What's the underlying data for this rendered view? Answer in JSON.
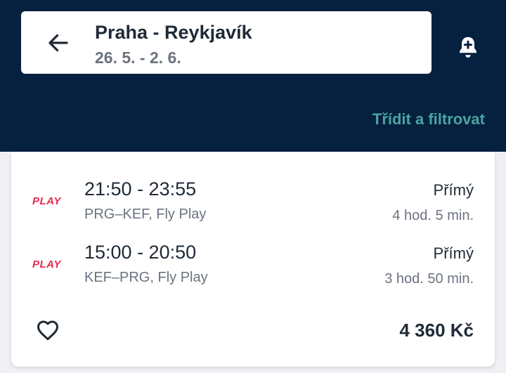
{
  "header": {
    "route": "Praha - Reykjavík",
    "dates": "26. 5. - 2. 6.",
    "sort_filter_label": "Třídit a filtrovat",
    "back_icon": "arrow-left-icon",
    "alert_icon": "bell-plus-icon"
  },
  "result": {
    "legs": [
      {
        "airline_logo": "PLAY",
        "times": "21:50 - 23:55",
        "route": "PRG–KEF, Fly Play",
        "stops": "Přímý",
        "duration": "4 hod. 5 min."
      },
      {
        "airline_logo": "PLAY",
        "times": "15:00 - 20:50",
        "route": "KEF–PRG, Fly Play",
        "stops": "Přímý",
        "duration": "3 hod. 50 min."
      }
    ],
    "price": "4 360 Kč",
    "favorite_icon": "heart-outline-icon"
  },
  "colors": {
    "header_bg": "#06203f",
    "accent": "#4aa3a3",
    "airline_brand": "#e8294a"
  }
}
